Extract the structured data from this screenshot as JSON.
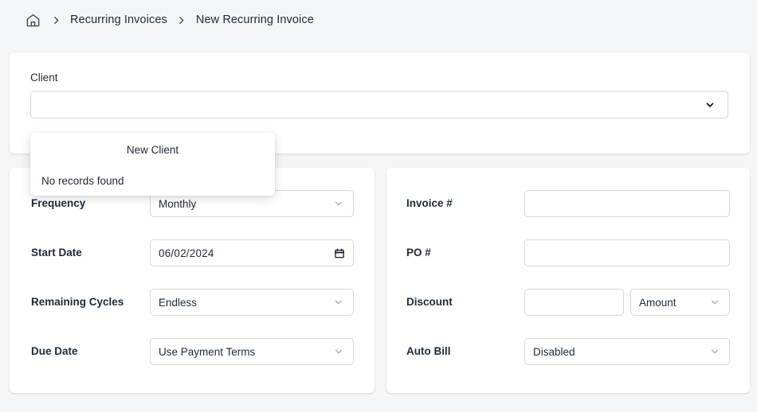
{
  "breadcrumb": {
    "home_icon": "home-icon",
    "separator": "chevron-right-icon",
    "items": [
      {
        "label": "Recurring Invoices"
      },
      {
        "label": "New Recurring Invoice"
      }
    ]
  },
  "client_section": {
    "label": "Client",
    "value": "",
    "chevron_icon": "chevron-down-icon"
  },
  "client_dropdown": {
    "new_client_label": "New Client",
    "empty_label": "No records found"
  },
  "left_card": {
    "rows": [
      {
        "label": "Frequency",
        "type": "select",
        "value": "Monthly"
      },
      {
        "label": "Start Date",
        "type": "date",
        "value": "06/02/2024"
      },
      {
        "label": "Remaining Cycles",
        "type": "select",
        "value": "Endless"
      },
      {
        "label": "Due Date",
        "type": "select",
        "value": "Use Payment Terms"
      }
    ]
  },
  "right_card": {
    "rows": [
      {
        "label": "Invoice #",
        "type": "text",
        "value": ""
      },
      {
        "label": "PO #",
        "type": "text",
        "value": ""
      },
      {
        "label": "Discount",
        "type": "split",
        "value": "",
        "type_value": "Amount"
      },
      {
        "label": "Auto Bill",
        "type": "select",
        "value": "Disabled"
      }
    ]
  },
  "colors": {
    "page_background": "#f4f5f6",
    "card_background": "#ffffff",
    "text": "#1f2937",
    "border": "#d5d7db",
    "chevron": "#9aa0a6"
  }
}
